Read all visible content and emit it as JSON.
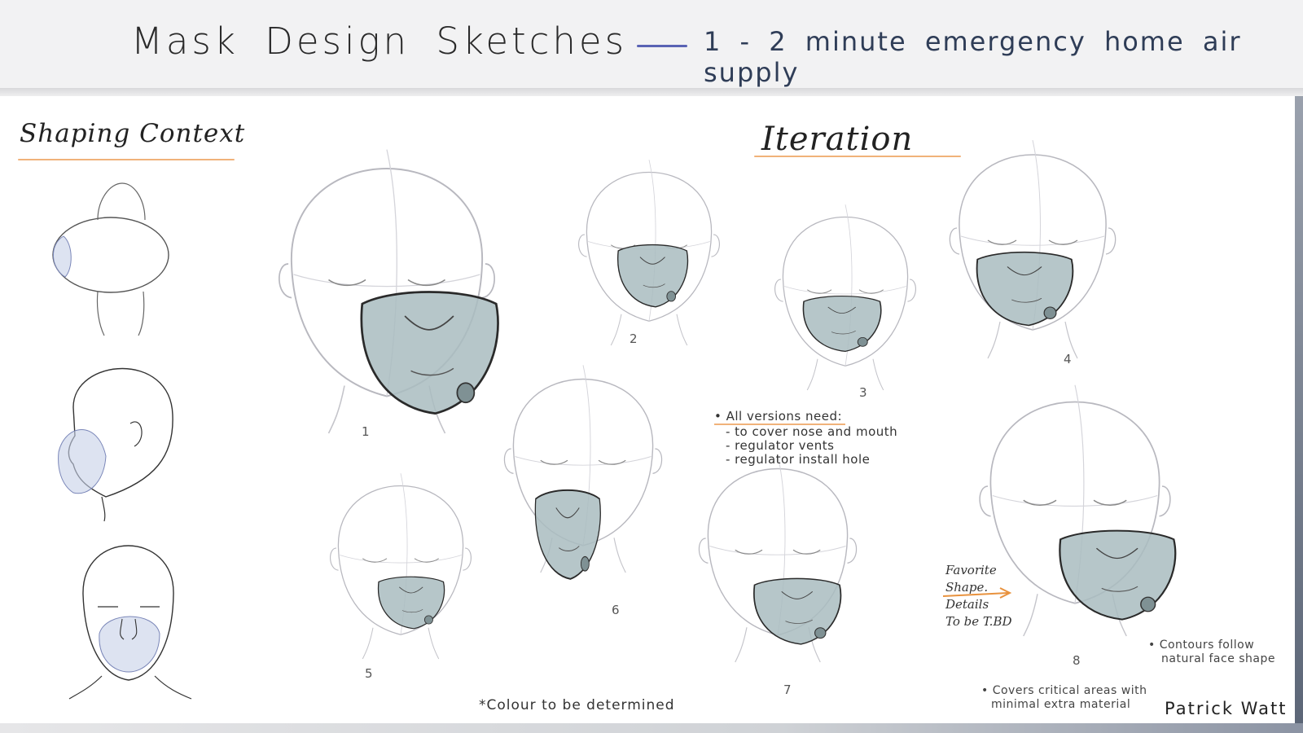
{
  "header": {
    "title": "Mask Design Sketches",
    "subtitle": "1 - 2 minute emergency home air supply",
    "accent_color": "#5a63b4"
  },
  "sections": {
    "shaping_context": "Shaping Context",
    "iteration": "Iteration",
    "underline_color": "#f0b27a"
  },
  "sketch_labels": [
    "1",
    "2",
    "3",
    "4",
    "5",
    "6",
    "7",
    "8"
  ],
  "requirements": {
    "heading": "• All versions need:",
    "items": [
      "- to cover nose and mouth",
      "- regulator vents",
      "- regulator install hole"
    ]
  },
  "favorite_note": [
    "Favorite",
    "Shape.",
    "Details",
    "To be T.BD"
  ],
  "notes": {
    "contours": [
      "• Contours follow",
      "natural face shape"
    ],
    "covers": [
      "• Covers critical areas with",
      "minimal extra material"
    ],
    "colour": "*Colour to be determined"
  },
  "author": "Patrick Watt",
  "mask_color": "#a9bcbf"
}
